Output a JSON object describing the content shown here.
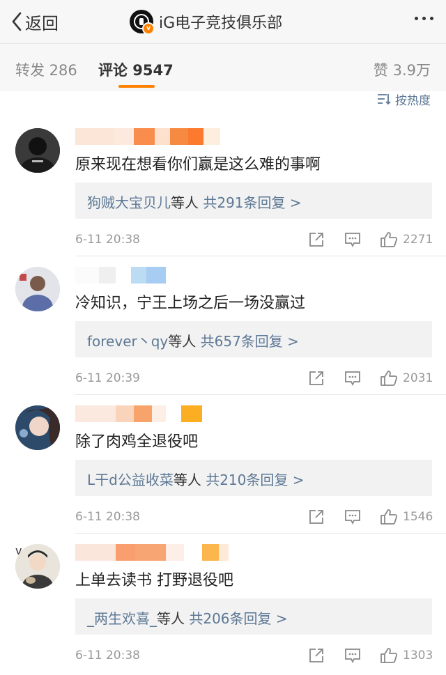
{
  "header": {
    "back_label": "返回",
    "title": "iG电子竞技俱乐部",
    "verified_badge": "v"
  },
  "tabs": {
    "repost": "转发 286",
    "comment": "评论 9547",
    "like": "赞 3.9万"
  },
  "sort_label": "按热度",
  "colors": {
    "accent": "#ff8200",
    "link": "#5d7895"
  },
  "comments": [
    {
      "text": "原来现在想看你们赢是这么难的事啊",
      "reply_users": "狗贼大宝贝儿",
      "reply_suffix": "等人",
      "reply_count": "共291条回复 >",
      "time": "6-11 20:38",
      "likes": "2271"
    },
    {
      "text": "冷知识，宁王上场之后一场没赢过",
      "reply_users": "forever丶qy",
      "reply_suffix": "等人",
      "reply_count": "共657条回复 >",
      "time": "6-11 20:39",
      "likes": "2031"
    },
    {
      "text": "除了肉鸡全退役吧",
      "reply_users": "L干d公益收菜",
      "reply_suffix": "等人",
      "reply_count": "共210条回复 >",
      "time": "6-11 20:38",
      "likes": "1546"
    },
    {
      "text": "上单去读书 打野退役吧",
      "reply_users": "_两生欢喜_",
      "reply_suffix": "等人",
      "reply_count": "共206条回复 >",
      "time": "6-11 20:38",
      "likes": "1303"
    }
  ],
  "icons": [
    "back-chevron-icon",
    "team-logo-icon",
    "more-icon",
    "sort-icon",
    "share-icon",
    "reply-icon",
    "like-icon"
  ]
}
